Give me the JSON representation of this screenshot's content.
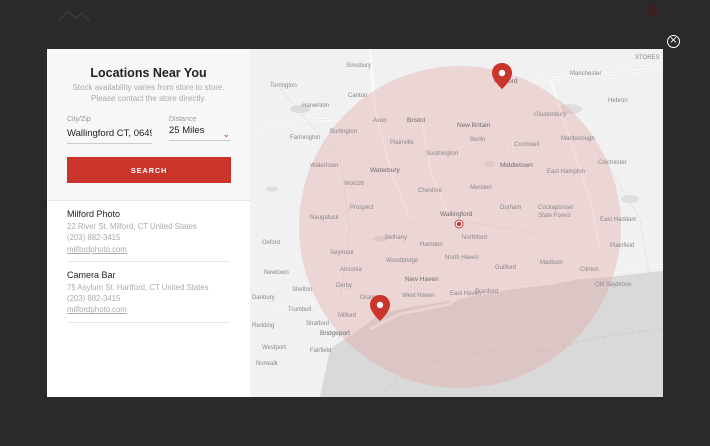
{
  "modal": {
    "title": "Locations Near You",
    "subtitle_line1": "Stock availability varies from store to store.",
    "subtitle_line2": "Please contact the store directly.",
    "city_label": "City/Zip",
    "city_value": "Wallingford CT, 0649",
    "distance_label": "Distance",
    "distance_value": "25 Miles",
    "search_label": "SEARCH",
    "close_icon": "close-icon"
  },
  "results": [
    {
      "name": "Milford Photo",
      "address": "22 River St. Milford, CT United States",
      "phone": "(203) 882-3415",
      "website": "milfordphoto.com"
    },
    {
      "name": "Camera Bar",
      "address": "75 Asylum St. Hartford, CT United States",
      "phone": "(203) 882-3415",
      "website": "milfordphoto.com"
    }
  ],
  "map": {
    "towns": {
      "hartford": "Hartford",
      "manchester": "Manchester",
      "glastonbury": "Glastonbury",
      "bristol": "Bristol",
      "new_britain": "New Britain",
      "southington": "Southington",
      "middletown": "Middletown",
      "waterbury": "Waterbury",
      "cheshire": "Cheshire",
      "wallingford": "Wallingford",
      "hamden": "Hamden",
      "new_haven": "New Haven",
      "west_haven": "West Haven",
      "branford": "Branford",
      "bridgeport": "Bridgeport",
      "fairfield": "Fairfield",
      "norwalk": "Norwalk",
      "cockaponset": "Cockaponset",
      "state_forest": "State Forest",
      "east_haddam": "East Haddam",
      "harwinton": "Harwinton",
      "torrington": "Torrington",
      "old_saybrook": "Old Saybrook",
      "plainfield": "Plainfield",
      "marlborough": "Marlborough",
      "durham": "Durham",
      "madison": "Madison",
      "clinton": "Clinton",
      "guilford": "Guilford",
      "stratford": "Stratford",
      "shelton": "Shelton",
      "trumbull": "Trumbull",
      "newtown": "Newtown",
      "danbury": "Danbury",
      "oxford": "Oxford",
      "meriden": "Meriden",
      "berlin": "Berlin",
      "cromwell": "Cromwell",
      "farmington": "Farmington",
      "plainville": "Plainville",
      "watertown": "Watertown",
      "wolcott": "Wolcott",
      "naugatuck": "Naugatuck",
      "northford": "Northford",
      "orange": "Orange",
      "milford": "Milford",
      "east_hampton": "East Hampton",
      "colchester": "Colchester",
      "hebron": "Hebron",
      "simsbury": "Simsbury",
      "avon": "Avon",
      "canton": "Canton",
      "burlington": "Burlington",
      "cheshire_n": "Prospect",
      "bethany": "Bethany",
      "woodbridge": "Woodbridge",
      "seymour": "Seymour",
      "ansonia": "Ansonia",
      "derby": "Derby",
      "north_haven": "North Haven",
      "east_haven": "East Haven",
      "westport": "Westport",
      "redding": "Redding",
      "stores": "STORES"
    },
    "pins": [
      "hartford-pin",
      "milford-pin",
      "wallingford-marker"
    ]
  }
}
